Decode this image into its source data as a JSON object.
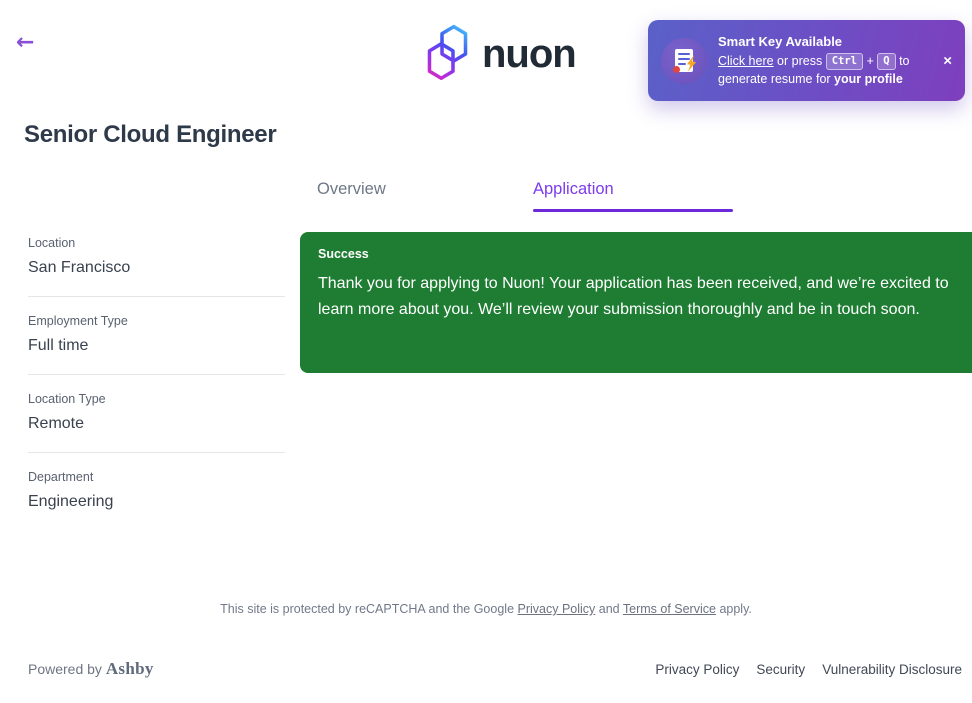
{
  "header": {
    "back_icon": "←",
    "logo_text": "nuon"
  },
  "notification": {
    "title": "Smart Key Available",
    "link_text": "Click here",
    "or_press": " or press ",
    "key1": "Ctrl",
    "plus": "+",
    "key2": "Q",
    "to": " to",
    "line2_prefix": "generate resume for ",
    "line2_bold": "your profile",
    "close_icon": "×"
  },
  "page": {
    "title": "Senior Cloud Engineer"
  },
  "tabs": [
    {
      "label": "Overview",
      "active": false
    },
    {
      "label": "Application",
      "active": true
    }
  ],
  "job_details": [
    {
      "label": "Location",
      "value": "San Francisco"
    },
    {
      "label": "Employment Type",
      "value": "Full time"
    },
    {
      "label": "Location Type",
      "value": "Remote"
    },
    {
      "label": "Department",
      "value": "Engineering"
    }
  ],
  "success": {
    "title": "Success",
    "message": "Thank you for applying to Nuon! Your application has been received, and we’re excited to learn more about you. We’ll review your submission thoroughly and be in touch soon."
  },
  "recaptcha": {
    "prefix": "This site is protected by reCAPTCHA and the Google ",
    "privacy_link": "Privacy Policy",
    "and": " and ",
    "terms_link": "Terms of Service",
    "suffix": " apply."
  },
  "footer": {
    "powered_by": "Powered by ",
    "brand": "Ashby",
    "links": [
      {
        "label": "Privacy Policy"
      },
      {
        "label": "Security"
      },
      {
        "label": "Vulnerability Disclosure"
      }
    ]
  },
  "colors": {
    "accent_purple": "#7c3bed",
    "tab_underline": "#6d28d9",
    "success_green": "#1e7d33",
    "toast_gradient_start": "#5a61c9",
    "toast_gradient_end": "#7e3fbe",
    "logo_cyan": "#45d4fb",
    "logo_blue": "#4253f0",
    "logo_purple": "#7a3bf0",
    "logo_pink": "#ff2f9e"
  }
}
